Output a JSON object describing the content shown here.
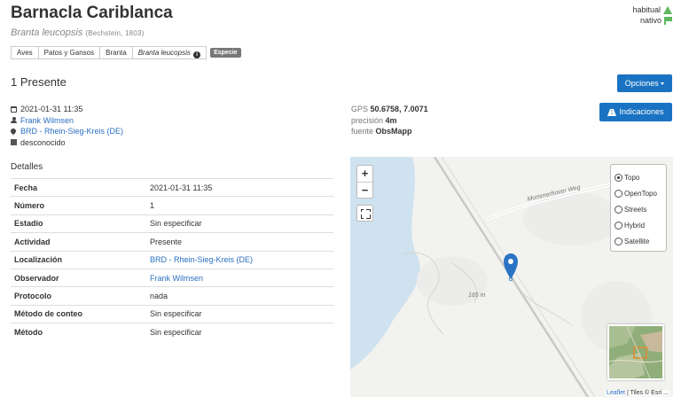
{
  "species": {
    "common_name": "Barnacla Cariblanca",
    "scientific_name": "Branta leucopsis",
    "author": "(Bechstein, 1803)"
  },
  "status": {
    "habitual": "habitual",
    "nativo": "nativo",
    "color": "#5cb85c"
  },
  "taxonomy": {
    "crumbs": [
      "Aves",
      "Patos y Gansos",
      "Branta",
      "Branta leucopsis"
    ],
    "rank": "Especie"
  },
  "observation_title": "1 Presente",
  "buttons": {
    "opciones": "Opciones",
    "indicaciones": "Indicaciones",
    "accent": "#1a73c2"
  },
  "meta": {
    "datetime": "2021-01-31 11:35",
    "observer": "Frank Wilmsen",
    "location": "BRD - Rhein-Sieg-Kreis (DE)",
    "substrate": "desconocido"
  },
  "gps": {
    "label": "GPS",
    "coords": "50.6758, 7.0071",
    "precision_label": "precisión",
    "precision": "4m",
    "source_label": "fuente",
    "source": "ObsMapp"
  },
  "details": {
    "heading": "Detalles",
    "rows": [
      {
        "key": "Fecha",
        "value": "2021-01-31 11:35"
      },
      {
        "key": "Número",
        "value": "1"
      },
      {
        "key": "Estadío",
        "value": "Sin especificar"
      },
      {
        "key": "Actividad",
        "value": "Presente"
      },
      {
        "key": "Localización",
        "value": "BRD - Rhein-Sieg-Kreis (DE)"
      },
      {
        "key": "Observador",
        "value": "Frank Wilmsen"
      },
      {
        "key": "Protocolo",
        "value": "nada"
      },
      {
        "key": "Método de conteo",
        "value": "Sin especificar"
      },
      {
        "key": "Método",
        "value": "Sin especificar"
      }
    ]
  },
  "map": {
    "zoom_in": "+",
    "zoom_out": "−",
    "layers": [
      "Topo",
      "OpenTopo",
      "Streets",
      "Hybrid",
      "Satellite"
    ],
    "selected_layer": "Topo",
    "road_label": "Mommerhover Weg",
    "elevation_label": "165 m",
    "attribution_link": "Leaflet",
    "attribution_text": " | Tiles © Esri ..."
  }
}
